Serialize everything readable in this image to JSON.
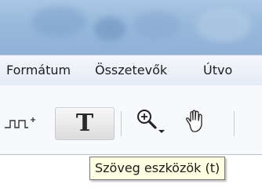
{
  "menu": {
    "items": [
      {
        "label": "Formátum"
      },
      {
        "label": "Összetevők"
      },
      {
        "label": "Útvo"
      }
    ]
  },
  "toolbar": {
    "connector_tool": {
      "icon": "connector-icon"
    },
    "text_tool": {
      "glyph": "T",
      "icon": "text-tool-icon",
      "state": "pressed"
    },
    "zoom_tool": {
      "icon": "magnifier-icon"
    },
    "hand_tool": {
      "icon": "hand-icon"
    }
  },
  "tooltip": {
    "text": "Szöveg eszközök (t)"
  },
  "colors": {
    "titlebar": "#98b9db",
    "menubar": "#e9eff7",
    "tooltip_bg": "#ffffe1",
    "tooltip_border": "#767676"
  }
}
